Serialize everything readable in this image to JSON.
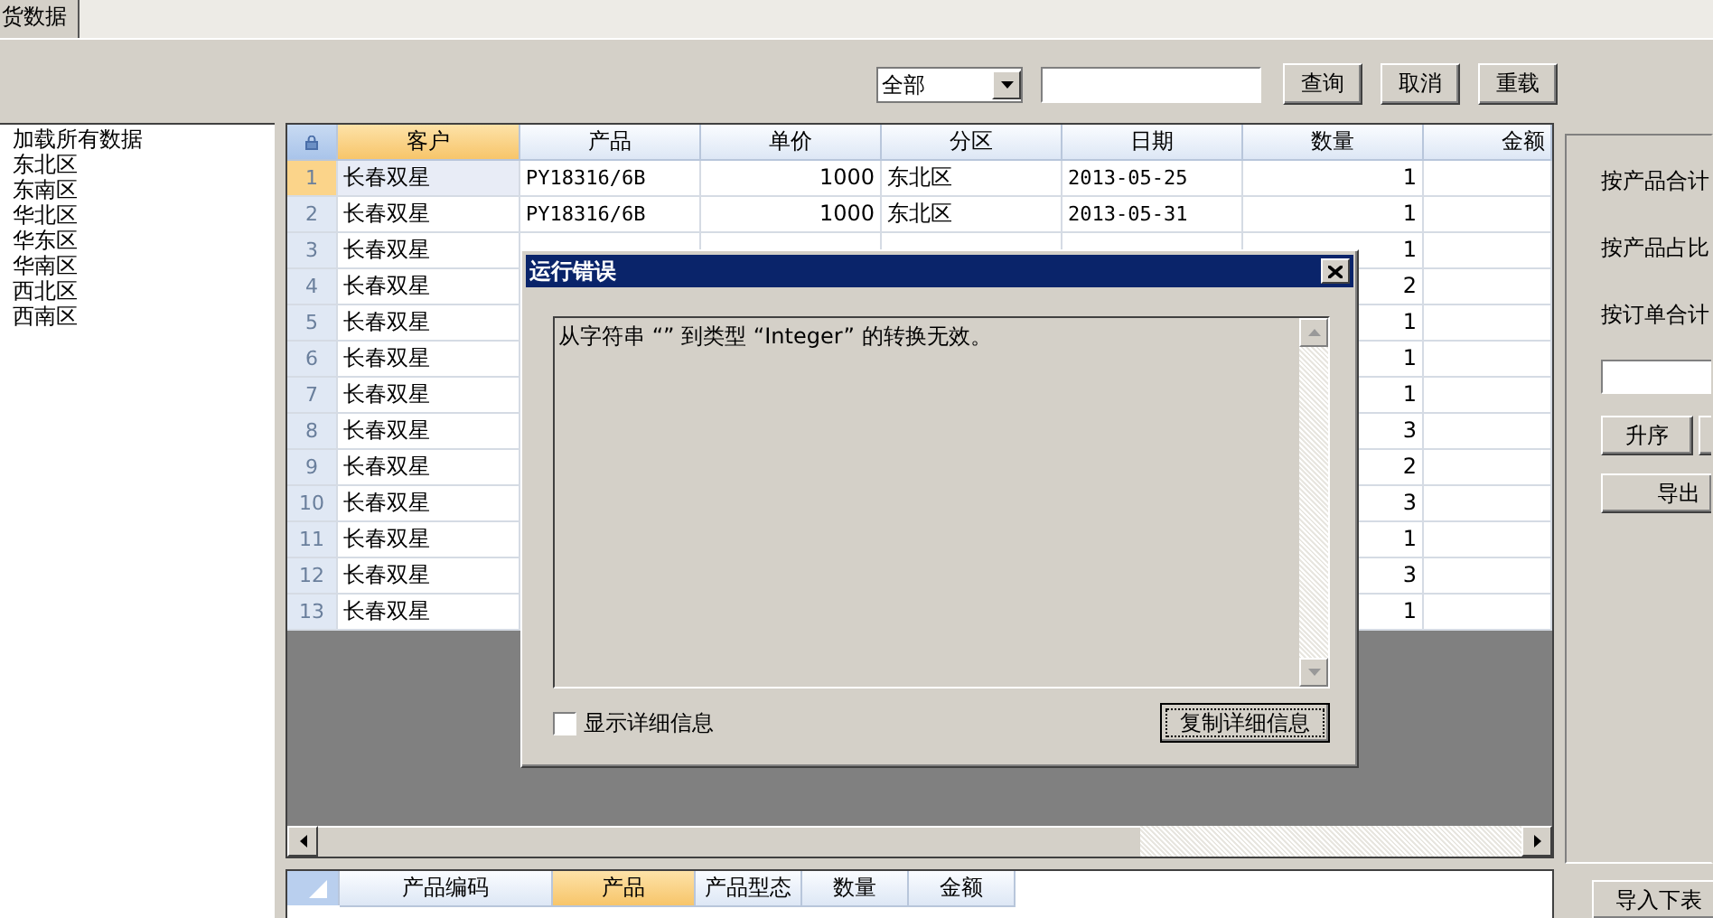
{
  "tabs": [
    {
      "label": "货数据",
      "selected": true
    }
  ],
  "toolbar": {
    "filter": {
      "value": "全部"
    },
    "buttons": [
      "查询",
      "取消",
      "重载"
    ]
  },
  "tree": {
    "items": [
      "加载所有数据",
      "东北区",
      "东南区",
      "华北区",
      "华东区",
      "华南区",
      "西北区",
      "西南区"
    ]
  },
  "grid": {
    "columns": [
      {
        "label": "客户",
        "selected": true
      },
      {
        "label": "产品",
        "selected": false
      },
      {
        "label": "单价",
        "selected": false
      },
      {
        "label": "分区",
        "selected": false
      },
      {
        "label": "日期",
        "selected": false
      },
      {
        "label": "数量",
        "selected": false
      },
      {
        "label": "金额",
        "selected": false
      }
    ],
    "rows": [
      {
        "number": "1",
        "selected": true,
        "cells": [
          "长春双星",
          "PY18316/6B",
          "1000",
          "东北区",
          "2013-05-25",
          "1",
          null
        ]
      },
      {
        "number": "2",
        "selected": false,
        "cells": [
          "长春双星",
          "PY18316/6B",
          "1000",
          "东北区",
          "2013-05-31",
          "1",
          null
        ]
      },
      {
        "number": "3",
        "selected": false,
        "cells": [
          "长春双星",
          null,
          null,
          null,
          null,
          "1",
          null
        ]
      },
      {
        "number": "4",
        "selected": false,
        "cells": [
          "长春双星",
          null,
          null,
          null,
          null,
          "2",
          null
        ]
      },
      {
        "number": "5",
        "selected": false,
        "cells": [
          "长春双星",
          null,
          null,
          null,
          null,
          "1",
          null
        ]
      },
      {
        "number": "6",
        "selected": false,
        "cells": [
          "长春双星",
          null,
          null,
          null,
          null,
          "1",
          null
        ]
      },
      {
        "number": "7",
        "selected": false,
        "cells": [
          "长春双星",
          null,
          null,
          null,
          null,
          "1",
          null
        ]
      },
      {
        "number": "8",
        "selected": false,
        "cells": [
          "长春双星",
          null,
          null,
          null,
          null,
          "3",
          null
        ]
      },
      {
        "number": "9",
        "selected": false,
        "cells": [
          "长春双星",
          null,
          null,
          null,
          null,
          "2",
          null
        ]
      },
      {
        "number": "10",
        "selected": false,
        "cells": [
          "长春双星",
          null,
          null,
          null,
          null,
          "3",
          null
        ]
      },
      {
        "number": "11",
        "selected": false,
        "cells": [
          "长春双星",
          null,
          null,
          null,
          null,
          "1",
          null
        ]
      },
      {
        "number": "12",
        "selected": false,
        "cells": [
          "长春双星",
          null,
          null,
          null,
          null,
          "3",
          null
        ]
      },
      {
        "number": "13",
        "selected": false,
        "cells": [
          "长春双星",
          null,
          null,
          null,
          null,
          "1",
          null
        ]
      }
    ]
  },
  "detail_grid": {
    "columns": [
      {
        "label": "产品编码",
        "selected": false
      },
      {
        "label": "产品",
        "selected": true
      },
      {
        "label": "产品型态",
        "selected": false
      },
      {
        "label": "数量",
        "selected": false
      },
      {
        "label": "金额",
        "selected": false
      }
    ]
  },
  "side_panel": {
    "labels": [
      "按产品合计",
      "按产品占比",
      "按订单合计"
    ],
    "buttons": [
      {
        "label": "升序",
        "kind": "normal"
      },
      {
        "kind": "blank"
      },
      {
        "label": "导出",
        "kind": "wide"
      }
    ],
    "import_button": "导入下表"
  },
  "dialog": {
    "title": "运行错误",
    "message": "从字符串 “” 到类型 “Integer” 的转换无效。",
    "checkbox": {
      "label": "显示详细信息",
      "checked": false
    },
    "button": "复制详细信息"
  }
}
